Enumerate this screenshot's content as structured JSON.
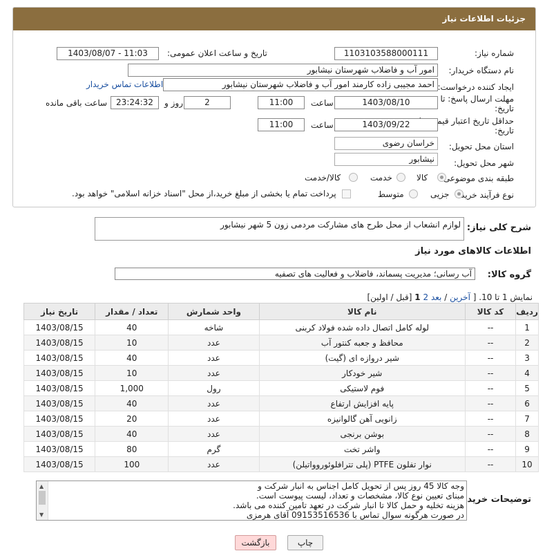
{
  "header": {
    "title": "جزئیات اطلاعات نیاز"
  },
  "form": {
    "need_number_label": "شماره نیاز:",
    "need_number": "1103103588000111",
    "announce_label": "تاریخ و ساعت اعلان عمومی:",
    "announce_value": "1403/08/07 - 11:03",
    "buyer_org_label": "نام دستگاه خریدار:",
    "buyer_org": "امور آب و فاضلاب شهرستان نیشابور",
    "creator_label": "ایجاد کننده درخواست:",
    "creator": "احمد مجیبی زاده کارمند امور آب و فاضلاب شهرستان نیشابور",
    "contact_link": "اطلاعات تماس خریدار",
    "deadline_label_1": "مهلت ارسال پاسخ: تا",
    "deadline_label_2": "تاریخ:",
    "deadline_date": "1403/08/10",
    "time_label": "ساعت",
    "deadline_time": "11:00",
    "days_value": "2",
    "days_label": "روز و",
    "remaining_time": "23:24:32",
    "remaining_label": "ساعت باقی مانده",
    "validity_label_1": "حداقل تاریخ اعتبار قیمت: تا",
    "validity_label_2": "تاریخ:",
    "validity_date": "1403/09/22",
    "validity_time": "11:00",
    "province_label": "استان محل تحویل:",
    "province": "خراسان رضوی",
    "city_label": "شهر محل تحویل:",
    "city": "نیشابور",
    "category_label": "طبقه بندی موضوعی:",
    "category_options": [
      "کالا",
      "خدمت",
      "کالا/خدمت"
    ],
    "category_selected": "کالا",
    "process_label": "نوع فرآیند خرید :",
    "process_options": [
      "جزیی",
      "متوسط"
    ],
    "process_selected": "جزیی",
    "payment_note": "پرداخت تمام یا بخشی از مبلغ خرید،از محل \"اسناد خزانه اسلامی\" خواهد بود."
  },
  "summary": {
    "label": "شرح کلی نیاز:",
    "value": "لوازم انشعاب از محل طرح های مشارکت مردمی زون 5 شهر نیشابور"
  },
  "goods_section_title": "اطلاعات کالاهای مورد نیاز",
  "goods_group": {
    "label": "گروه کالا:",
    "value": "آب رسانی؛ مدیریت پسماند، فاضلاب و فعالیت های تصفیه"
  },
  "pagination": {
    "prefix": "نمایش 1 تا 10. [",
    "last": "آخرین",
    "next": "بعد",
    "page2": "2",
    "page1": "1",
    "rest": "[قبل / اولین]"
  },
  "table": {
    "headers": [
      "ردیف",
      "کد کالا",
      "نام کالا",
      "واحد شمارش",
      "تعداد / مقدار",
      "تاریخ نیاز"
    ],
    "rows": [
      [
        "1",
        "--",
        "لوله کامل اتصال داده شده فولاد کربنی",
        "شاخه",
        "40",
        "1403/08/15"
      ],
      [
        "2",
        "--",
        "محافظ و جعبه کنتور آب",
        "عدد",
        "10",
        "1403/08/15"
      ],
      [
        "3",
        "--",
        "شیر دروازه ای (گیت)",
        "عدد",
        "40",
        "1403/08/15"
      ],
      [
        "4",
        "--",
        "شیر خودکار",
        "عدد",
        "10",
        "1403/08/15"
      ],
      [
        "5",
        "--",
        "فوم لاستیکی",
        "رول",
        "1,000",
        "1403/08/15"
      ],
      [
        "6",
        "--",
        "پایه افزایش ارتفاع",
        "عدد",
        "40",
        "1403/08/15"
      ],
      [
        "7",
        "--",
        "زانویی آهن گالوانیزه",
        "عدد",
        "20",
        "1403/08/15"
      ],
      [
        "8",
        "--",
        "بوشن برنجی",
        "عدد",
        "40",
        "1403/08/15"
      ],
      [
        "9",
        "--",
        "واشر تخت",
        "گرم",
        "80",
        "1403/08/15"
      ],
      [
        "10",
        "--",
        "نوار تفلون PTFE (پلی تترافلوئوروواتیلن)",
        "عدد",
        "100",
        "1403/08/15"
      ]
    ]
  },
  "buyer_notes": {
    "label": "توضیحات خریدار:",
    "lines": [
      "وجه کالا 45 روز پس از تحویل کامل اجناس به انبار شرکت و",
      "مبنای تعیین نوع کالا، مشخصات و تعداد، لیست پیوست است.",
      "هزینه تخلیه و حمل کالا تا انبار شرکت در تعهد تامین کننده می باشد.",
      "در صورت هرگونه سوال تماس با 09153516536 آقای هرمزی"
    ]
  },
  "buttons": {
    "print": "چاپ",
    "back": "بازگشت"
  },
  "colors": {
    "header_bg": "#8b6e3f",
    "link": "#1a4fa0",
    "back_button": "#ffd9d9"
  }
}
